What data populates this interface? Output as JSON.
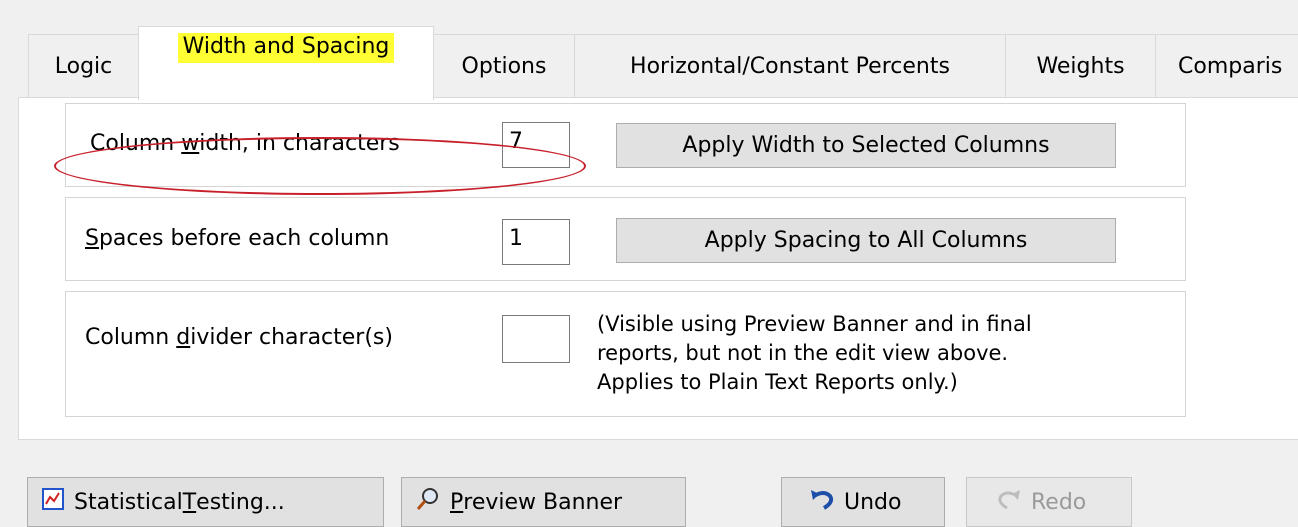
{
  "tabs": {
    "logic": "Logic",
    "width_spacing": "Width and Spacing",
    "options": "Options",
    "horizontal": "Horizontal/Constant Percents",
    "weights": "Weights",
    "comparisons": "Comparis"
  },
  "width_group": {
    "label_pre": "Column ",
    "label_u": "w",
    "label_post": "idth, in characters",
    "value": "7",
    "button": "Apply Width to Selected Columns"
  },
  "spacing_group": {
    "label_u": "S",
    "label_post": "paces before each column",
    "value": "1",
    "button": "Apply Spacing to All Columns"
  },
  "divider_group": {
    "label_pre": "Column ",
    "label_u": "d",
    "label_post": "ivider character(s)",
    "value": "",
    "note_line1": "(Visible using Preview Banner and in final",
    "note_line2": "reports, but not in the edit view above.",
    "note_line3": "Applies to Plain Text Reports only.)"
  },
  "bottom_buttons": {
    "stat_pre": "Statistical ",
    "stat_u": "T",
    "stat_post": "esting...",
    "preview_u": "P",
    "preview_post": "review Banner",
    "undo": "Undo",
    "redo": "Redo"
  },
  "icons": {
    "statistical": "chart-icon",
    "preview": "magnifier-icon",
    "undo": "undo-arrow-icon",
    "redo": "redo-arrow-icon"
  },
  "colors": {
    "tab_highlight": "#ffff33",
    "annotation_oval": "#c8202b"
  }
}
